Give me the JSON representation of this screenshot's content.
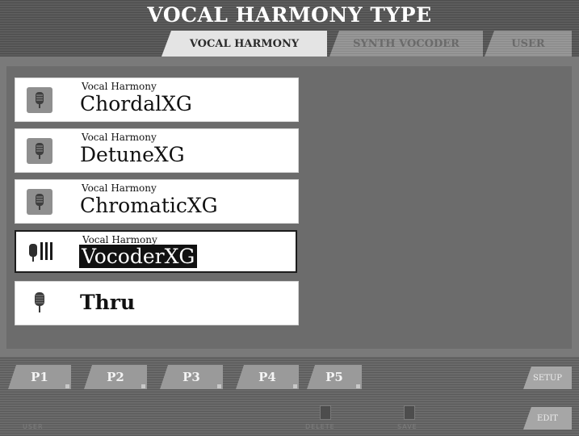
{
  "header": {
    "title": "VOCAL HARMONY TYPE",
    "tabs": [
      {
        "label": "VOCAL HARMONY",
        "active": true
      },
      {
        "label": "SYNTH VOCODER",
        "active": false
      },
      {
        "label": "USER",
        "active": false
      }
    ]
  },
  "list": {
    "items": [
      {
        "category": "Vocal Harmony",
        "name": "ChordalXG",
        "icon": "microphone-icon",
        "selected": false
      },
      {
        "category": "Vocal Harmony",
        "name": "DetuneXG",
        "icon": "microphone-icon",
        "selected": false
      },
      {
        "category": "Vocal Harmony",
        "name": "ChromaticXG",
        "icon": "microphone-icon",
        "selected": false
      },
      {
        "category": "Vocal Harmony",
        "name": "VocoderXG",
        "icon": "vocoder-microphone-icon",
        "selected": true
      },
      {
        "category": "",
        "name": "Thru",
        "icon": "microphone-icon",
        "selected": false
      }
    ]
  },
  "footer": {
    "page_buttons": [
      "P1",
      "P2",
      "P3",
      "P4",
      "P5"
    ],
    "setup_label": "SETUP",
    "edit_label": "EDIT",
    "lower_left_label": "USER",
    "lower_mid_labels": [
      "DELETE",
      "SAVE"
    ]
  },
  "colors": {
    "accent_dark": "#111111",
    "panel": "#7a7a7a",
    "item_bg": "#ffffff"
  }
}
